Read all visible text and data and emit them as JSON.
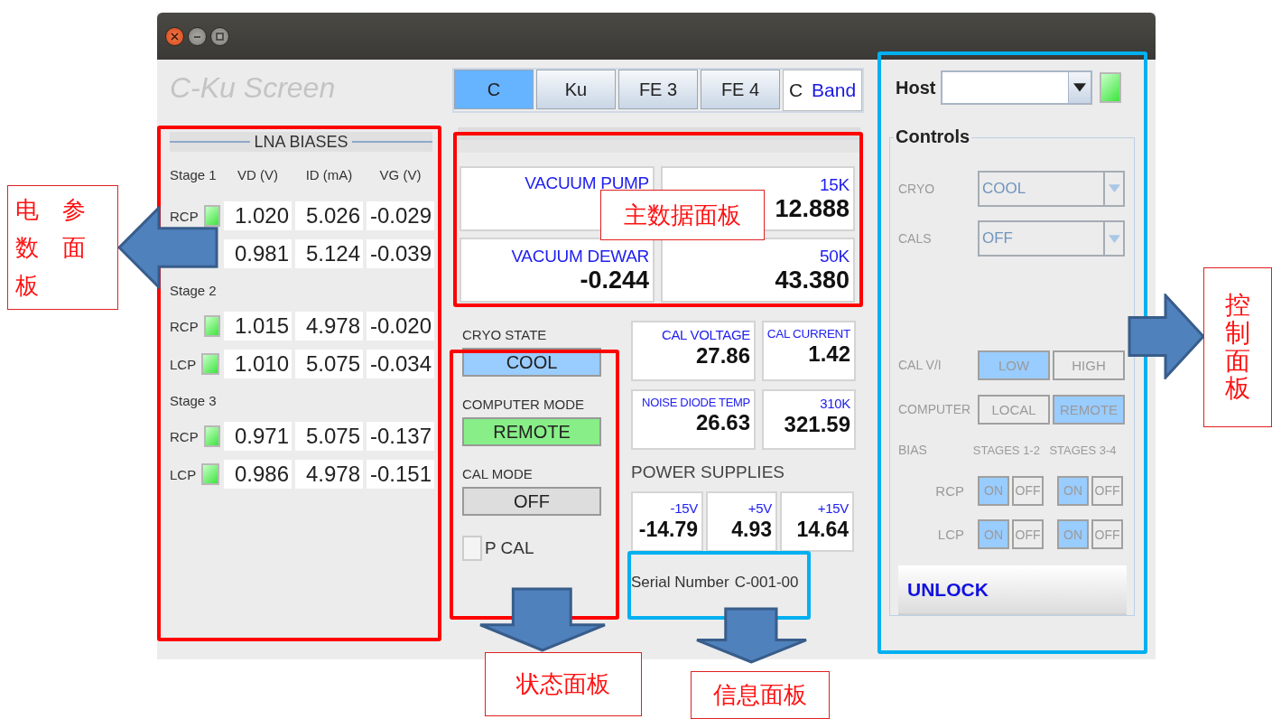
{
  "screen_title": "C-Ku Screen",
  "band_tabs": [
    {
      "label": "C",
      "selected": true
    },
    {
      "label": "Ku",
      "selected": false
    },
    {
      "label": "FE 3",
      "selected": false
    },
    {
      "label": "FE 4",
      "selected": false
    }
  ],
  "band_display": {
    "value": "C",
    "unit": "Band"
  },
  "lna_biases": {
    "title": "LNA BIASES",
    "columns": [
      "VD (V)",
      "ID (mA)",
      "VG (V)"
    ],
    "stages": [
      {
        "label": "Stage 1",
        "rows": [
          {
            "label": "RCP",
            "ok": true,
            "values": [
              "1.020",
              "5.026",
              "-0.029"
            ]
          },
          {
            "values": [
              "0.981",
              "5.124",
              "-0.039"
            ]
          }
        ]
      },
      {
        "label": "Stage 2",
        "rows": [
          {
            "label": "RCP",
            "ok": true,
            "values": [
              "1.015",
              "4.978",
              "-0.020"
            ]
          },
          {
            "label": "LCP",
            "ok": true,
            "values": [
              "1.010",
              "5.075",
              "-0.034"
            ]
          }
        ]
      },
      {
        "label": "Stage 3",
        "rows": [
          {
            "label": "RCP",
            "ok": true,
            "values": [
              "0.971",
              "5.075",
              "-0.137"
            ]
          },
          {
            "label": "LCP",
            "ok": true,
            "values": [
              "0.986",
              "4.978",
              "-0.151"
            ]
          }
        ]
      }
    ]
  },
  "readings": [
    {
      "label": "VACUUM PUMP"
    },
    {
      "label": "15K",
      "value": "12.888"
    },
    {
      "label": "VACUUM DEWAR",
      "value": "-0.244"
    },
    {
      "label": "50K",
      "value": "43.380"
    }
  ],
  "status": [
    {
      "label": "CRYO STATE",
      "value": "COOL",
      "color": "#99ccff"
    },
    {
      "label": "COMPUTER MODE",
      "value": "REMOTE",
      "color": "#88ee88"
    },
    {
      "label": "CAL MODE",
      "value": "OFF",
      "color": "#dddddd"
    }
  ],
  "p_cal": {
    "label": "P CAL",
    "checked": false
  },
  "cal_readings": [
    {
      "label": "CAL VOLTAGE",
      "value": "27.86"
    },
    {
      "label": "CAL CURRENT",
      "value": "1.42"
    },
    {
      "label": "NOISE DIODE TEMP",
      "value": "26.63"
    },
    {
      "label": "310K",
      "value": "321.59"
    }
  ],
  "power_supplies": {
    "title": "POWER SUPPLIES",
    "items": [
      {
        "label": "-15V",
        "value": "-14.79"
      },
      {
        "label": "+5V",
        "value": "4.93"
      },
      {
        "label": "+15V",
        "value": "14.64"
      }
    ]
  },
  "serial": {
    "label": "Serial Number",
    "value": "C-001-00"
  },
  "controls": {
    "host_label": "Host",
    "host_ok": true,
    "title": "Controls",
    "disabled": true,
    "dropdowns": [
      {
        "label": "CRYO",
        "value": "COOL"
      },
      {
        "label": "CALS",
        "value": "OFF"
      }
    ],
    "toggles": [
      {
        "label": "CAL V/I",
        "options": [
          {
            "label": "LOW",
            "selected": true
          },
          {
            "label": "HIGH",
            "selected": false
          }
        ]
      },
      {
        "label": "COMPUTER",
        "options": [
          {
            "label": "LOCAL",
            "selected": false
          },
          {
            "label": "REMOTE",
            "selected": true
          }
        ]
      }
    ],
    "bias": {
      "label": "BIAS",
      "groups": [
        "STAGES 1-2",
        "STAGES 3-4"
      ],
      "rows": [
        {
          "label": "RCP",
          "switches": [
            [
              {
                "label": "ON",
                "selected": true
              },
              {
                "label": "OFF",
                "selected": false
              }
            ],
            [
              {
                "label": "ON",
                "selected": true
              },
              {
                "label": "OFF",
                "selected": false
              }
            ]
          ]
        },
        {
          "label": "LCP",
          "switches": [
            [
              {
                "label": "ON",
                "selected": true
              },
              {
                "label": "OFF",
                "selected": false
              }
            ],
            [
              {
                "label": "ON",
                "selected": true
              },
              {
                "label": "OFF",
                "selected": false
              }
            ]
          ]
        }
      ]
    },
    "unlock": "UNLOCK"
  },
  "annotations": [
    {
      "label": "电参数面板",
      "color": "#ff0000"
    },
    {
      "label": "主数据面板",
      "color": "#ff0000"
    },
    {
      "label": "状态面板",
      "color": "#ff0000"
    },
    {
      "label": "信息面板",
      "color": "#00b0f0"
    },
    {
      "label": "控制面板",
      "color": "#00b0f0"
    }
  ]
}
